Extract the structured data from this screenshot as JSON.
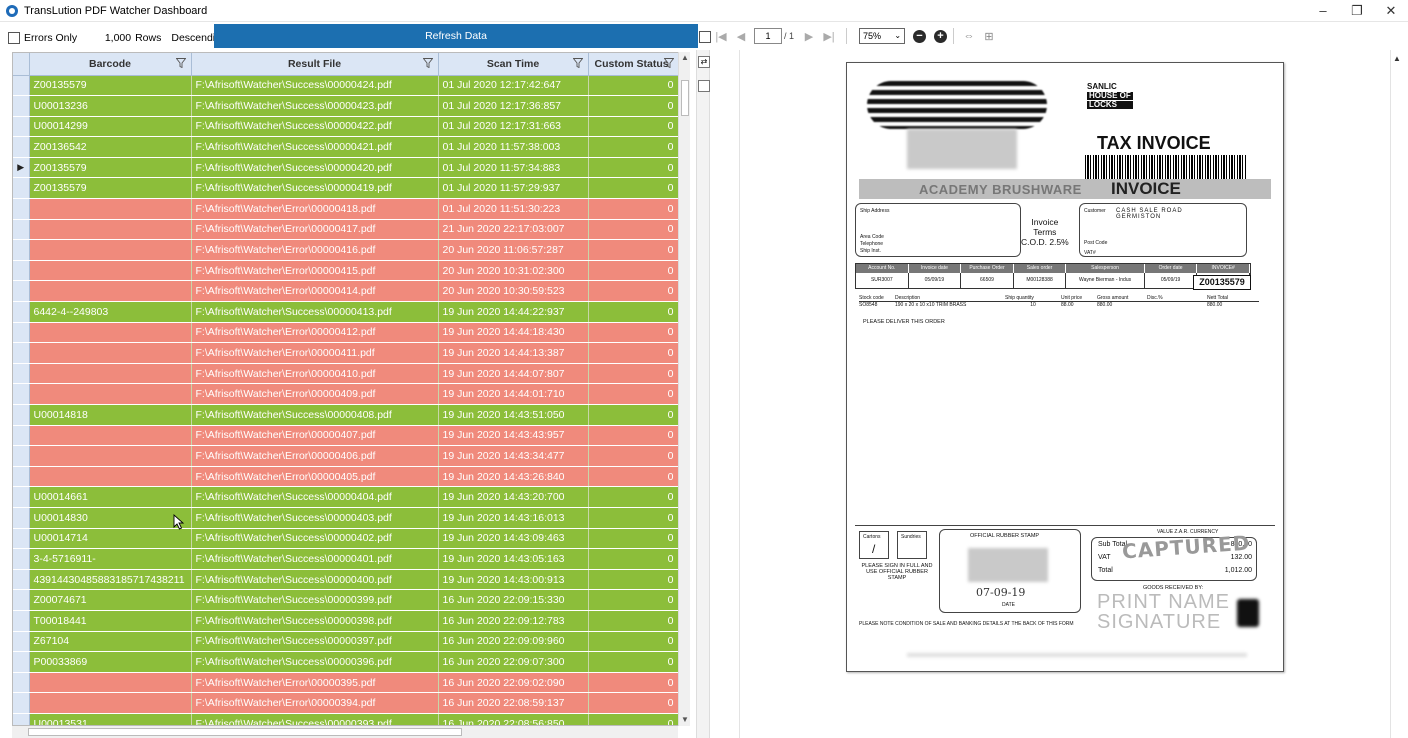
{
  "window": {
    "title": "TransLution PDF Watcher Dashboard",
    "controls": [
      "–",
      "❐",
      "✕"
    ]
  },
  "toolbar": {
    "errors_only_label": "Errors Only",
    "errors_only_checked": false,
    "rows_value": "1,000",
    "rows_label": "Rows",
    "descending_label": "Descending",
    "descending_checked": true,
    "refresh_label": "Refresh Data"
  },
  "grid": {
    "columns": [
      "Barcode",
      "Result File",
      "Scan Time",
      "Custom Status"
    ],
    "rows": [
      {
        "status": "ok",
        "barcode": "Z00135579",
        "file": "F:\\Afrisoft\\Watcher\\Success\\00000424.pdf",
        "time": "01 Jul 2020 12:17:42:647",
        "custom": "0"
      },
      {
        "status": "ok",
        "barcode": "U00013236",
        "file": "F:\\Afrisoft\\Watcher\\Success\\00000423.pdf",
        "time": "01 Jul 2020 12:17:36:857",
        "custom": "0"
      },
      {
        "status": "ok",
        "barcode": "U00014299",
        "file": "F:\\Afrisoft\\Watcher\\Success\\00000422.pdf",
        "time": "01 Jul 2020 12:17:31:663",
        "custom": "0"
      },
      {
        "status": "ok",
        "barcode": "Z00136542",
        "file": "F:\\Afrisoft\\Watcher\\Success\\00000421.pdf",
        "time": "01 Jul 2020 11:57:38:003",
        "custom": "0"
      },
      {
        "status": "ok",
        "barcode": "Z00135579",
        "file": "F:\\Afrisoft\\Watcher\\Success\\00000420.pdf",
        "time": "01 Jul 2020 11:57:34:883",
        "custom": "0",
        "current": true
      },
      {
        "status": "ok",
        "barcode": "Z00135579",
        "file": "F:\\Afrisoft\\Watcher\\Success\\00000419.pdf",
        "time": "01 Jul 2020 11:57:29:937",
        "custom": "0"
      },
      {
        "status": "err",
        "barcode": "",
        "file": "F:\\Afrisoft\\Watcher\\Error\\00000418.pdf",
        "time": "01 Jul 2020 11:51:30:223",
        "custom": "0"
      },
      {
        "status": "err",
        "barcode": "",
        "file": "F:\\Afrisoft\\Watcher\\Error\\00000417.pdf",
        "time": "21 Jun 2020 22:17:03:007",
        "custom": "0"
      },
      {
        "status": "err",
        "barcode": "",
        "file": "F:\\Afrisoft\\Watcher\\Error\\00000416.pdf",
        "time": "20 Jun 2020 11:06:57:287",
        "custom": "0"
      },
      {
        "status": "err",
        "barcode": "",
        "file": "F:\\Afrisoft\\Watcher\\Error\\00000415.pdf",
        "time": "20 Jun 2020 10:31:02:300",
        "custom": "0"
      },
      {
        "status": "err",
        "barcode": "",
        "file": "F:\\Afrisoft\\Watcher\\Error\\00000414.pdf",
        "time": "20 Jun 2020 10:30:59:523",
        "custom": "0"
      },
      {
        "status": "ok",
        "barcode": "6442-4--249803",
        "file": "F:\\Afrisoft\\Watcher\\Success\\00000413.pdf",
        "time": "19 Jun 2020 14:44:22:937",
        "custom": "0"
      },
      {
        "status": "err",
        "barcode": "",
        "file": "F:\\Afrisoft\\Watcher\\Error\\00000412.pdf",
        "time": "19 Jun 2020 14:44:18:430",
        "custom": "0"
      },
      {
        "status": "err",
        "barcode": "",
        "file": "F:\\Afrisoft\\Watcher\\Error\\00000411.pdf",
        "time": "19 Jun 2020 14:44:13:387",
        "custom": "0"
      },
      {
        "status": "err",
        "barcode": "",
        "file": "F:\\Afrisoft\\Watcher\\Error\\00000410.pdf",
        "time": "19 Jun 2020 14:44:07:807",
        "custom": "0"
      },
      {
        "status": "err",
        "barcode": "",
        "file": "F:\\Afrisoft\\Watcher\\Error\\00000409.pdf",
        "time": "19 Jun 2020 14:44:01:710",
        "custom": "0"
      },
      {
        "status": "ok",
        "barcode": "U00014818",
        "file": "F:\\Afrisoft\\Watcher\\Success\\00000408.pdf",
        "time": "19 Jun 2020 14:43:51:050",
        "custom": "0"
      },
      {
        "status": "err",
        "barcode": "",
        "file": "F:\\Afrisoft\\Watcher\\Error\\00000407.pdf",
        "time": "19 Jun 2020 14:43:43:957",
        "custom": "0"
      },
      {
        "status": "err",
        "barcode": "",
        "file": "F:\\Afrisoft\\Watcher\\Error\\00000406.pdf",
        "time": "19 Jun 2020 14:43:34:477",
        "custom": "0"
      },
      {
        "status": "err",
        "barcode": "",
        "file": "F:\\Afrisoft\\Watcher\\Error\\00000405.pdf",
        "time": "19 Jun 2020 14:43:26:840",
        "custom": "0"
      },
      {
        "status": "ok",
        "barcode": "U00014661",
        "file": "F:\\Afrisoft\\Watcher\\Success\\00000404.pdf",
        "time": "19 Jun 2020 14:43:20:700",
        "custom": "0"
      },
      {
        "status": "ok",
        "barcode": "U00014830",
        "file": "F:\\Afrisoft\\Watcher\\Success\\00000403.pdf",
        "time": "19 Jun 2020 14:43:16:013",
        "custom": "0"
      },
      {
        "status": "ok",
        "barcode": "U00014714",
        "file": "F:\\Afrisoft\\Watcher\\Success\\00000402.pdf",
        "time": "19 Jun 2020 14:43:09:463",
        "custom": "0"
      },
      {
        "status": "ok",
        "barcode": "3-4-5716911-",
        "file": "F:\\Afrisoft\\Watcher\\Success\\00000401.pdf",
        "time": "19 Jun 2020 14:43:05:163",
        "custom": "0"
      },
      {
        "status": "ok",
        "barcode": "4391443048588318571743821​1",
        "file": "F:\\Afrisoft\\Watcher\\Success\\00000400.pdf",
        "time": "19 Jun 2020 14:43:00:913",
        "custom": "0"
      },
      {
        "status": "ok",
        "barcode": "Z00074671",
        "file": "F:\\Afrisoft\\Watcher\\Success\\00000399.pdf",
        "time": "16 Jun 2020 22:09:15:330",
        "custom": "0"
      },
      {
        "status": "ok",
        "barcode": "T00018441",
        "file": "F:\\Afrisoft\\Watcher\\Success\\00000398.pdf",
        "time": "16 Jun 2020 22:09:12:783",
        "custom": "0"
      },
      {
        "status": "ok",
        "barcode": "Z67104",
        "file": "F:\\Afrisoft\\Watcher\\Success\\00000397.pdf",
        "time": "16 Jun 2020 22:09:09:960",
        "custom": "0"
      },
      {
        "status": "ok",
        "barcode": "P00033869",
        "file": "F:\\Afrisoft\\Watcher\\Success\\00000396.pdf",
        "time": "16 Jun 2020 22:09:07:300",
        "custom": "0"
      },
      {
        "status": "err",
        "barcode": "",
        "file": "F:\\Afrisoft\\Watcher\\Error\\00000395.pdf",
        "time": "16 Jun 2020 22:09:02:090",
        "custom": "0"
      },
      {
        "status": "err",
        "barcode": "",
        "file": "F:\\Afrisoft\\Watcher\\Error\\00000394.pdf",
        "time": "16 Jun 2020 22:08:59:137",
        "custom": "0"
      },
      {
        "status": "ok",
        "barcode": "U00013531",
        "file": "F:\\Afrisoft\\Watcher\\Success\\00000393.pdf",
        "time": "16 Jun 2020 22:08:56:850",
        "custom": "0"
      }
    ]
  },
  "viewer": {
    "page_current": "1",
    "page_total": "/ 1",
    "zoom": "75%",
    "invoice": {
      "brand_line1": "SANLIC",
      "brand_line2": "HOUSE OF",
      "brand_line3": "LOCKS",
      "title": "TAX INVOICE",
      "band_academy": "ACADEMY BRUSHWARE",
      "band_invoice": "INVOICE",
      "ship_address": "Ship Address",
      "area_code": "Area Code",
      "telephone": "Telephone",
      "ship_inst": "Ship Inst.",
      "terms": [
        "Invoice",
        "Terms",
        "C.O.D. 2.5%"
      ],
      "customer_label": "Customer",
      "customer_value": "CASH SALE ROAD GERMISTON",
      "post_code": "Post Code",
      "vat_label": "VAT#",
      "table_headers": [
        "Account No.",
        "Invoice date",
        "Purchase Order",
        "Sales order",
        "Salesperson",
        "Order date",
        "INVOICE#"
      ],
      "table_values": [
        "SUR3007",
        "05/09/19",
        "66509",
        "M00128388",
        "Wayne Bierman - Indus",
        "05/09/19",
        "Z00135579"
      ],
      "line_headers": [
        "Stock code",
        "Description",
        "Ship quantity",
        "Unit price",
        "Gross amount",
        "Disc.%",
        "Nett Total"
      ],
      "line_values": [
        "SO8548",
        "190 x 20 x 10 x10 TRIM BRASS",
        "10",
        "88.00",
        "880.00",
        "",
        "880.00"
      ],
      "deliver_note": "PLEASE DELIVER THIS ORDER",
      "cartons": "Cartons",
      "sundries": "Sundries",
      "stamp_label": "OFFICIAL RUBBER STAMP",
      "sign_note": "PLEASE SIGN IN FULL AND USE OFFICIAL RUBBER STAMP",
      "currency": "VALUE Z.A.R. CURRENCY",
      "subtotal_label": "Sub Total",
      "subtotal": "880.00",
      "vat": "132.00",
      "total_label": "Total",
      "total": "1,012.00",
      "goods_received": "GOODS RECEIVED BY:",
      "date_handwritten": "07-09-19",
      "date_label": "DATE",
      "captured": "CAPTURED",
      "print_name": "PRINT NAME",
      "signature": "SIGNATURE",
      "condition_note": "PLEASE NOTE CONDITION OF SALE AND BANKING DETAILS AT THE BACK OF THIS FORM"
    }
  }
}
